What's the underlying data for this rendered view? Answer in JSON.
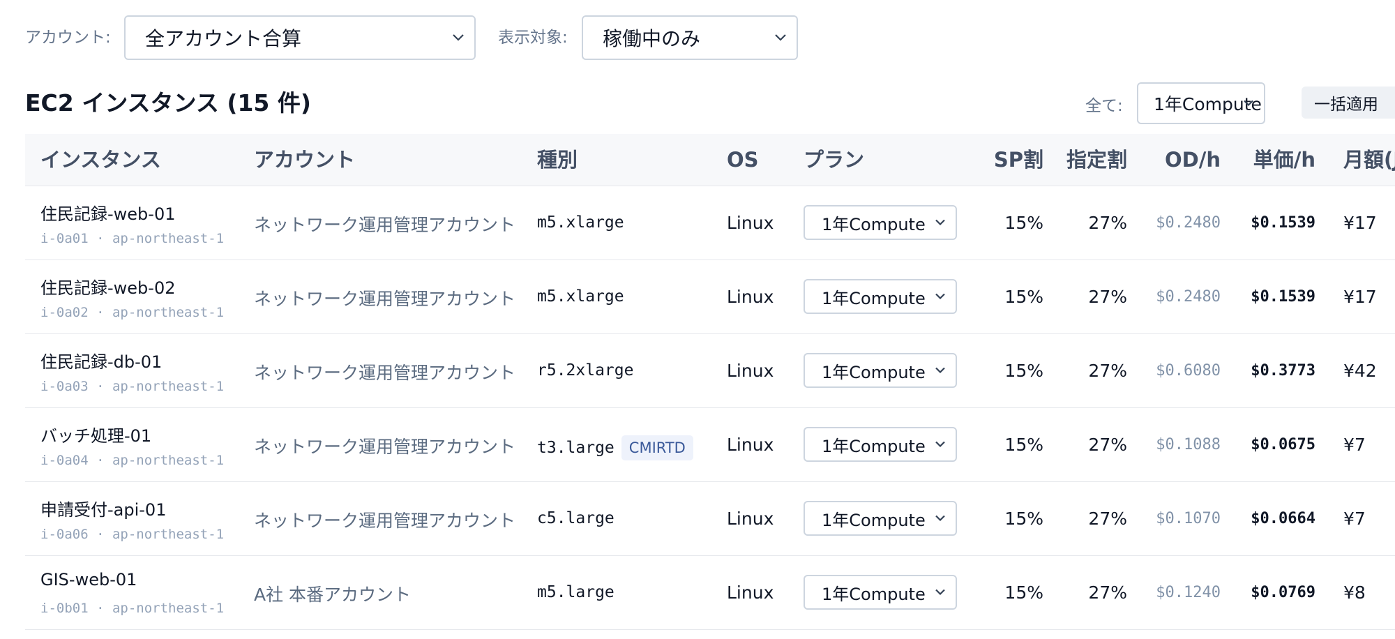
{
  "filters": {
    "account_label": "アカウント:",
    "account_value": "全アカウント合算",
    "target_label": "表示対象:",
    "target_value": "稼働中のみ"
  },
  "section": {
    "title": "EC2 インスタンス (15 件)",
    "bulk_label": "全て:",
    "bulk_value": "1年Compute",
    "bulk_button": "一括適用"
  },
  "table": {
    "headers": [
      "インスタンス",
      "アカウント",
      "種別",
      "OS",
      "プラン",
      "SP割",
      "指定割",
      "OD/h",
      "単価/h",
      "月額(J"
    ],
    "rows": [
      {
        "name": "住民記録-web-01",
        "sub": "i-0a01 · ap-northeast-1",
        "account": "ネットワーク運用管理アカウント",
        "type": "m5.xlarge",
        "badge": "",
        "os": "Linux",
        "plan": "1年Compute",
        "sp": "15%",
        "designated": "27%",
        "od": "$0.2480",
        "unit": "$0.1539",
        "monthly": "¥17"
      },
      {
        "name": "住民記録-web-02",
        "sub": "i-0a02 · ap-northeast-1",
        "account": "ネットワーク運用管理アカウント",
        "type": "m5.xlarge",
        "badge": "",
        "os": "Linux",
        "plan": "1年Compute",
        "sp": "15%",
        "designated": "27%",
        "od": "$0.2480",
        "unit": "$0.1539",
        "monthly": "¥17"
      },
      {
        "name": "住民記録-db-01",
        "sub": "i-0a03 · ap-northeast-1",
        "account": "ネットワーク運用管理アカウント",
        "type": "r5.2xlarge",
        "badge": "",
        "os": "Linux",
        "plan": "1年Compute",
        "sp": "15%",
        "designated": "27%",
        "od": "$0.6080",
        "unit": "$0.3773",
        "monthly": "¥42"
      },
      {
        "name": "バッチ処理-01",
        "sub": "i-0a04 · ap-northeast-1",
        "account": "ネットワーク運用管理アカウント",
        "type": "t3.large",
        "badge": "CMIRTD",
        "os": "Linux",
        "plan": "1年Compute",
        "sp": "15%",
        "designated": "27%",
        "od": "$0.1088",
        "unit": "$0.0675",
        "monthly": "¥7"
      },
      {
        "name": "申請受付-api-01",
        "sub": "i-0a06 · ap-northeast-1",
        "account": "ネットワーク運用管理アカウント",
        "type": "c5.large",
        "badge": "",
        "os": "Linux",
        "plan": "1年Compute",
        "sp": "15%",
        "designated": "27%",
        "od": "$0.1070",
        "unit": "$0.0664",
        "monthly": "¥7"
      },
      {
        "name": "GIS-web-01",
        "sub": "i-0b01 · ap-northeast-1",
        "account": "A社 本番アカウント",
        "type": "m5.large",
        "badge": "",
        "os": "Linux",
        "plan": "1年Compute",
        "sp": "15%",
        "designated": "27%",
        "od": "$0.1240",
        "unit": "$0.0769",
        "monthly": "¥8"
      }
    ]
  },
  "icons": {
    "dropdown": "chevron-down-icon"
  }
}
